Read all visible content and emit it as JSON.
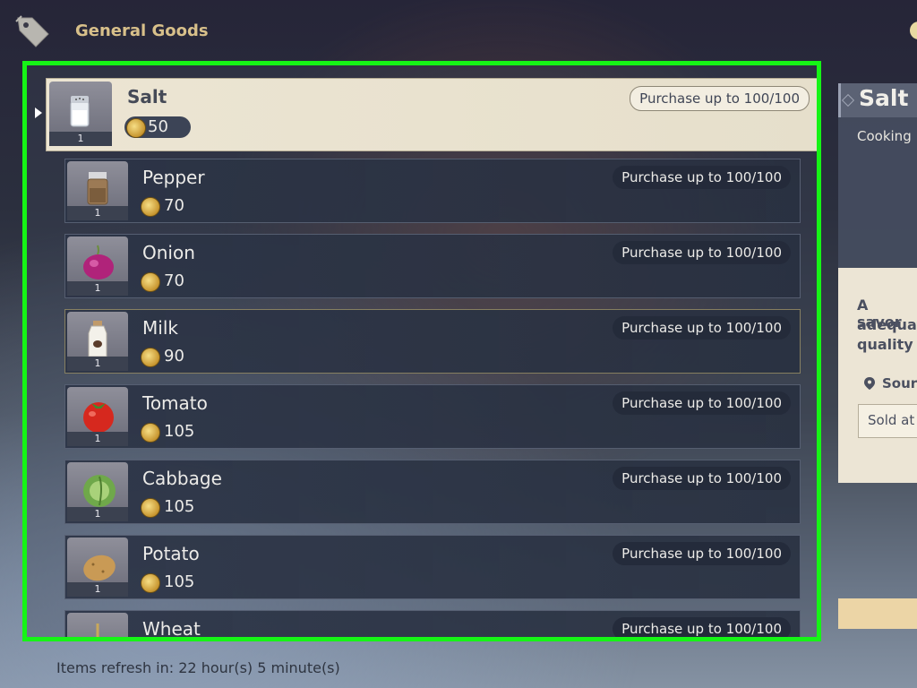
{
  "header": {
    "shop_title": "General Goods",
    "shop_icon": "price-tag-icon"
  },
  "items": [
    {
      "name": "Salt",
      "price": "50",
      "qty": "1",
      "limit": "Purchase up to 100/100",
      "icon": "salt-shaker-icon",
      "selected": true
    },
    {
      "name": "Pepper",
      "price": "70",
      "qty": "1",
      "limit": "Purchase up to 100/100",
      "icon": "pepper-jar-icon"
    },
    {
      "name": "Onion",
      "price": "70",
      "qty": "1",
      "limit": "Purchase up to 100/100",
      "icon": "onion-icon"
    },
    {
      "name": "Milk",
      "price": "90",
      "qty": "1",
      "limit": "Purchase up to 100/100",
      "icon": "milk-bottle-icon"
    },
    {
      "name": "Tomato",
      "price": "105",
      "qty": "1",
      "limit": "Purchase up to 100/100",
      "icon": "tomato-icon"
    },
    {
      "name": "Cabbage",
      "price": "105",
      "qty": "1",
      "limit": "Purchase up to 100/100",
      "icon": "cabbage-icon"
    },
    {
      "name": "Potato",
      "price": "105",
      "qty": "1",
      "limit": "Purchase up to 100/100",
      "icon": "potato-icon"
    },
    {
      "name": "Wheat",
      "price": "",
      "qty": "",
      "limit": "Purchase up to 100/100",
      "icon": "wheat-icon"
    }
  ],
  "footer": {
    "refresh_text": "Items refresh in: 22 hour(s) 5 minute(s)"
  },
  "detail": {
    "title": "Salt",
    "type": "Cooking",
    "desc_lines": [
      "A savor",
      "adequat",
      "quality"
    ],
    "source_label": "Sour",
    "source_value": "Sold at"
  },
  "colors": {
    "highlight_frame": "#16f416",
    "coin_gold": "#d9a93a",
    "selected_row_bg": "#ece5d3"
  }
}
